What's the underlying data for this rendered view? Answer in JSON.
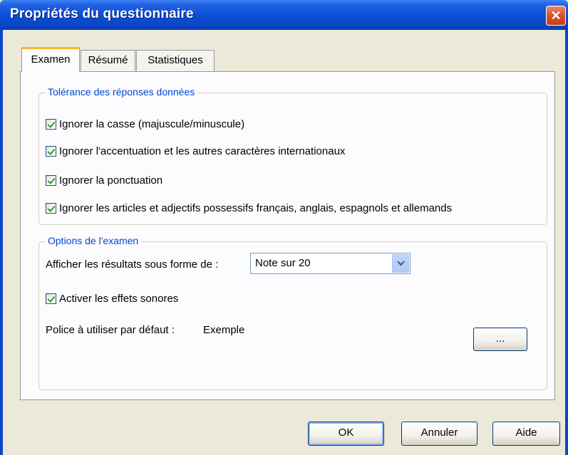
{
  "window": {
    "title": "Propriétés du questionnaire",
    "close_glyph": "✕"
  },
  "tabs": [
    {
      "label": "Examen",
      "active": true
    },
    {
      "label": "Résumé",
      "active": false
    },
    {
      "label": "Statistiques",
      "active": false
    }
  ],
  "tolerance": {
    "legend": "Tolérance des réponses données",
    "options": [
      {
        "label": "Ignorer la casse (majuscule/minuscule)",
        "checked": true
      },
      {
        "label": "Ignorer l'accentuation et les autres caractères internationaux",
        "checked": true
      },
      {
        "label": "Ignorer la ponctuation",
        "checked": true
      },
      {
        "label": "Ignorer les articles et adjectifs possessifs français, anglais, espagnols et allemands",
        "checked": true
      }
    ]
  },
  "exam_options": {
    "legend": "Options de l'examen",
    "display_label": "Afficher les résultats sous forme de :",
    "display_value": "Note sur 20",
    "sound_label": "Activer les effets sonores",
    "sound_checked": true,
    "font_label": "Police à utiliser par défaut :",
    "font_value": "Exemple",
    "font_button_label": "..."
  },
  "buttons": {
    "ok": "OK",
    "cancel": "Annuler",
    "help": "Aide"
  },
  "colors": {
    "titlebar": "#0a4fd8",
    "legend_text": "#0046d5",
    "check_mark": "#21a121",
    "close_button": "#d8532c"
  }
}
